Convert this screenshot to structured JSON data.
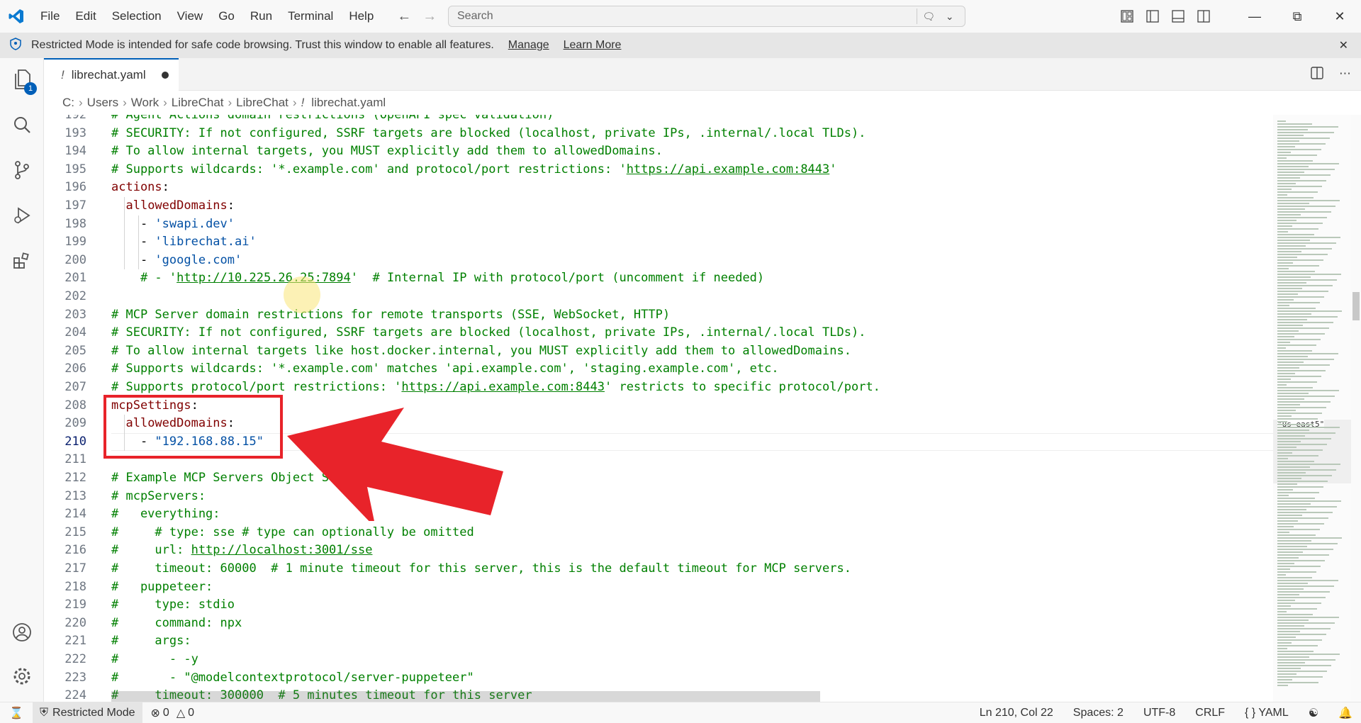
{
  "menu": [
    "File",
    "Edit",
    "Selection",
    "View",
    "Go",
    "Run",
    "Terminal",
    "Help"
  ],
  "search": {
    "placeholder": "Search"
  },
  "banner": {
    "message": "Restricted Mode is intended for safe code browsing. Trust this window to enable all features.",
    "manage": "Manage",
    "learn_more": "Learn More"
  },
  "activity": {
    "explorer_badge": "1"
  },
  "tab": {
    "name": "librechat.yaml",
    "icon_glyph": "!"
  },
  "breadcrumb": [
    "C:",
    "Users",
    "Work",
    "LibreChat",
    "LibreChat",
    "librechat.yaml"
  ],
  "editor": {
    "lines": [
      {
        "n": "192",
        "segs": [
          {
            "t": "# Agent Actions domain restrictions (OpenAPI spec validation)",
            "c": "cmt"
          }
        ]
      },
      {
        "n": "193",
        "segs": [
          {
            "t": "# SECURITY: If not configured, SSRF targets are blocked (localhost, private IPs, .internal/.local TLDs).",
            "c": "cmt"
          }
        ]
      },
      {
        "n": "194",
        "segs": [
          {
            "t": "# To allow internal targets, you MUST explicitly add them to allowedDomains.",
            "c": "cmt"
          }
        ]
      },
      {
        "n": "195",
        "segs": [
          {
            "t": "# Supports wildcards: '*.example.com' and protocol/port restrictions: '",
            "c": "cmt"
          },
          {
            "t": "https://api.example.com:8443",
            "c": "cmt url"
          },
          {
            "t": "'",
            "c": "cmt"
          }
        ]
      },
      {
        "n": "196",
        "segs": [
          {
            "t": "actions",
            "c": "key"
          },
          {
            "t": ":",
            "c": ""
          }
        ]
      },
      {
        "n": "197",
        "segs": [
          {
            "t": "  ",
            "c": ""
          },
          {
            "t": "allowedDomains",
            "c": "key"
          },
          {
            "t": ":",
            "c": ""
          }
        ]
      },
      {
        "n": "198",
        "segs": [
          {
            "t": "    - ",
            "c": ""
          },
          {
            "t": "'swapi.dev'",
            "c": "str"
          }
        ]
      },
      {
        "n": "199",
        "segs": [
          {
            "t": "    - ",
            "c": ""
          },
          {
            "t": "'librechat.ai'",
            "c": "str"
          }
        ]
      },
      {
        "n": "200",
        "segs": [
          {
            "t": "    - ",
            "c": ""
          },
          {
            "t": "'google.com'",
            "c": "str"
          }
        ]
      },
      {
        "n": "201",
        "segs": [
          {
            "t": "    # - '",
            "c": "cmt"
          },
          {
            "t": "http://10.225.26.25:7894",
            "c": "cmt url"
          },
          {
            "t": "'  # Internal IP with protocol/port (uncomment if needed)",
            "c": "cmt"
          }
        ]
      },
      {
        "n": "202",
        "segs": []
      },
      {
        "n": "203",
        "segs": [
          {
            "t": "# MCP Server domain restrictions for remote transports (SSE, WebSocket, HTTP)",
            "c": "cmt"
          }
        ]
      },
      {
        "n": "204",
        "segs": [
          {
            "t": "# SECURITY: If not configured, SSRF targets are blocked (localhost, private IPs, .internal/.local TLDs).",
            "c": "cmt"
          }
        ]
      },
      {
        "n": "205",
        "segs": [
          {
            "t": "# To allow internal targets like host.docker.internal, you MUST explicitly add them to allowedDomains.",
            "c": "cmt"
          }
        ]
      },
      {
        "n": "206",
        "segs": [
          {
            "t": "# Supports wildcards: '*.example.com' matches 'api.example.com', 'staging.example.com', etc.",
            "c": "cmt"
          }
        ]
      },
      {
        "n": "207",
        "segs": [
          {
            "t": "# Supports protocol/port restrictions: '",
            "c": "cmt"
          },
          {
            "t": "https://api.example.com:8443",
            "c": "cmt url"
          },
          {
            "t": "' restricts to specific protocol/port.",
            "c": "cmt"
          }
        ]
      },
      {
        "n": "208",
        "segs": [
          {
            "t": "mcpSettings",
            "c": "key"
          },
          {
            "t": ":",
            "c": ""
          }
        ]
      },
      {
        "n": "209",
        "segs": [
          {
            "t": "  ",
            "c": ""
          },
          {
            "t": "allowedDomains",
            "c": "key"
          },
          {
            "t": ":",
            "c": ""
          }
        ]
      },
      {
        "n": "210",
        "segs": [
          {
            "t": "    - ",
            "c": ""
          },
          {
            "t": "\"192.168.88.15\"",
            "c": "str"
          }
        ]
      },
      {
        "n": "211",
        "segs": []
      },
      {
        "n": "212",
        "segs": [
          {
            "t": "# Example MCP Servers Object Str",
            "c": "cmt"
          }
        ]
      },
      {
        "n": "213",
        "segs": [
          {
            "t": "# mcpServers:",
            "c": "cmt"
          }
        ]
      },
      {
        "n": "214",
        "segs": [
          {
            "t": "#   everything:",
            "c": "cmt"
          }
        ]
      },
      {
        "n": "215",
        "segs": [
          {
            "t": "#     # type: sse # type can optionally be omitted",
            "c": "cmt"
          }
        ]
      },
      {
        "n": "216",
        "segs": [
          {
            "t": "#     url: ",
            "c": "cmt"
          },
          {
            "t": "http://localhost:3001/sse",
            "c": "cmt url"
          }
        ]
      },
      {
        "n": "217",
        "segs": [
          {
            "t": "#     timeout: 60000  # 1 minute timeout for this server, this is the default timeout for MCP servers.",
            "c": "cmt"
          }
        ]
      },
      {
        "n": "218",
        "segs": [
          {
            "t": "#   puppeteer:",
            "c": "cmt"
          }
        ]
      },
      {
        "n": "219",
        "segs": [
          {
            "t": "#     type: stdio",
            "c": "cmt"
          }
        ]
      },
      {
        "n": "220",
        "segs": [
          {
            "t": "#     command: npx",
            "c": "cmt"
          }
        ]
      },
      {
        "n": "221",
        "segs": [
          {
            "t": "#     args:",
            "c": "cmt"
          }
        ]
      },
      {
        "n": "222",
        "segs": [
          {
            "t": "#       - -y",
            "c": "cmt"
          }
        ]
      },
      {
        "n": "223",
        "segs": [
          {
            "t": "#       - \"@modelcontextprotocol/server-puppeteer\"",
            "c": "cmt"
          }
        ]
      },
      {
        "n": "224",
        "segs": [
          {
            "t": "#     timeout: 300000  # 5 minutes timeout for this server",
            "c": "cmt"
          }
        ]
      }
    ],
    "current_line": "210",
    "minimap_highlight": "\"us-east5\""
  },
  "status": {
    "restricted": "Restricted Mode",
    "errors": "0",
    "warnings": "0",
    "position": "Ln 210, Col 22",
    "spaces": "Spaces: 2",
    "encoding": "UTF-8",
    "eol": "CRLF",
    "language": "YAML",
    "language_glyph": "{ }"
  },
  "colors": {
    "accent": "#005fb8",
    "annotation": "#e8232a",
    "comment": "#008000",
    "key": "#800000",
    "string": "#0451a5"
  }
}
